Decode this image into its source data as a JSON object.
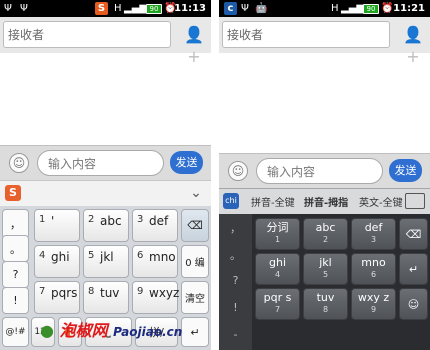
{
  "left": {
    "status": {
      "time": "11:13",
      "signal": "H",
      "battery": "90"
    },
    "recipient": {
      "placeholder": "接收者"
    },
    "composer": {
      "placeholder": "输入内容",
      "send": "发送"
    },
    "keyboard": {
      "left_col": [
        "，",
        "。",
        "?",
        "!"
      ],
      "keys": [
        {
          "num": "1",
          "label": "'"
        },
        {
          "num": "2",
          "label": "abc"
        },
        {
          "num": "3",
          "label": "def"
        },
        {
          "num": "4",
          "label": "ghi"
        },
        {
          "num": "5",
          "label": "jkl"
        },
        {
          "num": "6",
          "label": "mno"
        },
        {
          "num": "7",
          "label": "pqrs"
        },
        {
          "num": "8",
          "label": "tuv"
        },
        {
          "num": "9",
          "label": "wxyz"
        }
      ],
      "right_col": [
        "0 编",
        "清空"
      ],
      "bottom": [
        "@!#",
        "123",
        "拼/",
        "space"
      ]
    }
  },
  "right": {
    "status": {
      "time": "11:21",
      "signal": "H",
      "battery": "90"
    },
    "recipient": {
      "placeholder": "接收者"
    },
    "composer": {
      "placeholder": "输入内容",
      "send": "发送"
    },
    "keyboard": {
      "modes": [
        "拼音-全键",
        "拼音-拇指",
        "英文-全键"
      ],
      "left_col": [
        "，",
        "。",
        "?",
        "!",
        "-"
      ],
      "keys": [
        {
          "top": "分词",
          "bottom": "1"
        },
        {
          "top": "abc",
          "bottom": "2"
        },
        {
          "top": "def",
          "bottom": "3"
        },
        {
          "top": "ghi",
          "bottom": "4"
        },
        {
          "top": "jkl",
          "bottom": "5"
        },
        {
          "top": "mno",
          "bottom": "6"
        },
        {
          "top": "pqr s",
          "bottom": "7"
        },
        {
          "top": "tuv",
          "bottom": "8"
        },
        {
          "top": "wxy z",
          "bottom": "9"
        }
      ]
    }
  },
  "watermark": {
    "brand": "泡椒网",
    "domain": "Paojiao.cn"
  }
}
